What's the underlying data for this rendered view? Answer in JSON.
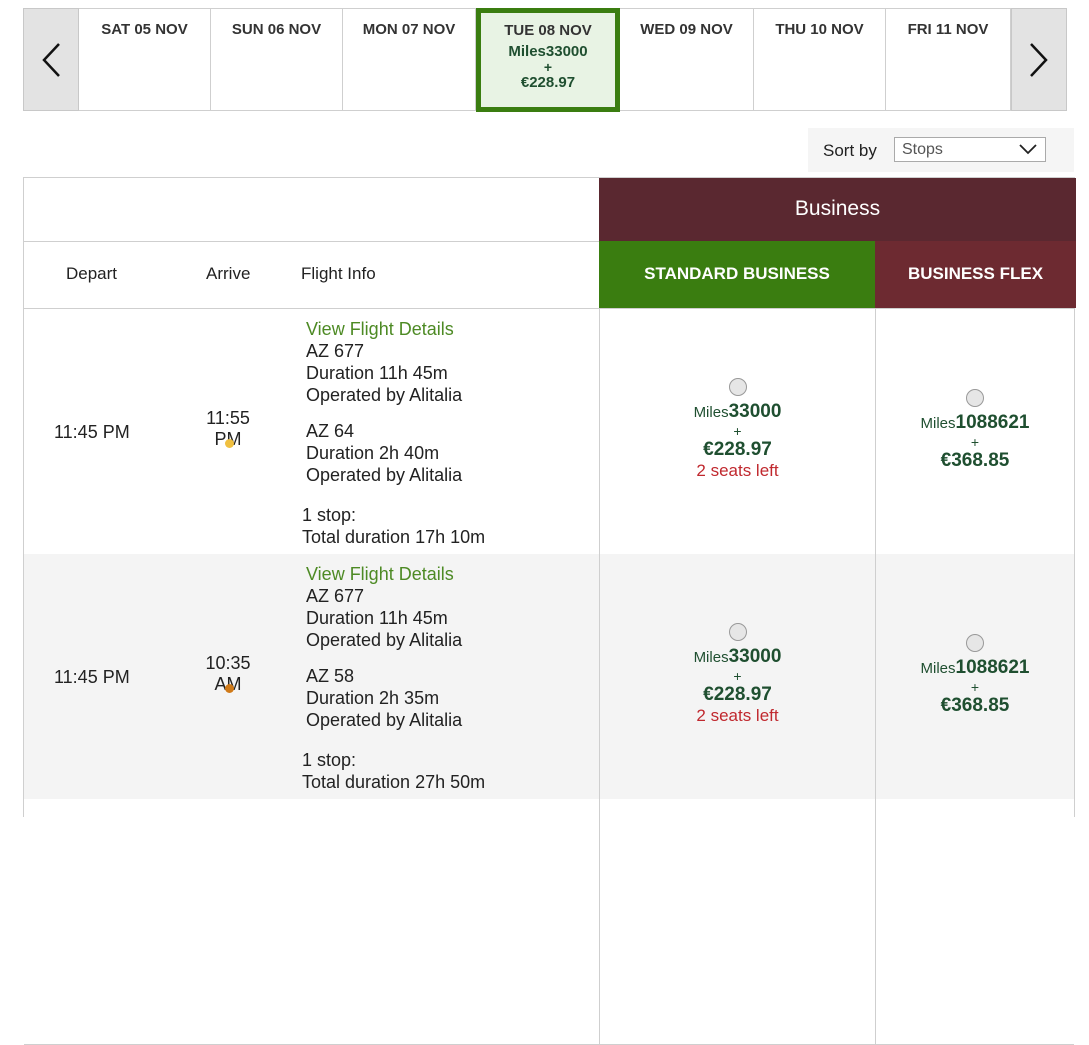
{
  "dates": [
    {
      "label": "SAT 05 NOV"
    },
    {
      "label": "SUN 06 NOV"
    },
    {
      "label": "MON 07 NOV"
    },
    {
      "label": "TUE 08 NOV",
      "selected": true,
      "miles": "Miles33000",
      "plus": "+",
      "price": "€228.97"
    },
    {
      "label": "WED 09 NOV"
    },
    {
      "label": "THU 10 NOV"
    },
    {
      "label": "FRI 11 NOV"
    }
  ],
  "icons": {
    "prev": "chevron-left-icon",
    "next": "chevron-right-icon",
    "dropdown": "chevron-down-icon"
  },
  "sort": {
    "label": "Sort by",
    "value": "Stops"
  },
  "cabin": {
    "title": "Business"
  },
  "columns": {
    "depart": "Depart",
    "arrive": "Arrive",
    "info": "Flight Info",
    "standard": "STANDARD BUSINESS",
    "flex": "BUSINESS FLEX"
  },
  "colors": {
    "green": "#3a7d10",
    "maroon": "#5a2830",
    "flex": "#6d2a31",
    "price": "#1f4f30",
    "alert": "#c0282e",
    "link": "#4d8a24"
  },
  "flights": [
    {
      "depart": "11:45 PM",
      "arrive": "11:55 PM",
      "dot_color": "#f0c040",
      "details_link": "View Flight Details",
      "seg1": {
        "flight": "AZ 677",
        "duration": "Duration 11h 45m",
        "operator": "Operated by Alitalia"
      },
      "seg2": {
        "flight": "AZ 64",
        "duration": "Duration 2h 40m",
        "operator": "Operated by Alitalia"
      },
      "stops": "1 stop:",
      "total": "Total duration 17h 10m",
      "standard": {
        "miles_label": "Miles",
        "miles": "33000",
        "plus": "+",
        "price": "€228.97",
        "seats": "2 seats left"
      },
      "flex": {
        "miles_label": "Miles",
        "miles": "1088621",
        "plus": "+",
        "price": "€368.85"
      }
    },
    {
      "depart": "11:45 PM",
      "arrive": "10:35 AM",
      "dot_color": "#d07a18",
      "details_link": "View Flight Details",
      "seg1": {
        "flight": "AZ 677",
        "duration": "Duration 11h 45m",
        "operator": "Operated by Alitalia"
      },
      "seg2": {
        "flight": "AZ 58",
        "duration": "Duration 2h 35m",
        "operator": "Operated by Alitalia"
      },
      "stops": "1 stop:",
      "total": "Total duration 27h 50m",
      "standard": {
        "miles_label": "Miles",
        "miles": "33000",
        "plus": "+",
        "price": "€228.97",
        "seats": "2 seats left"
      },
      "flex": {
        "miles_label": "Miles",
        "miles": "1088621",
        "plus": "+",
        "price": "€368.85"
      }
    }
  ]
}
